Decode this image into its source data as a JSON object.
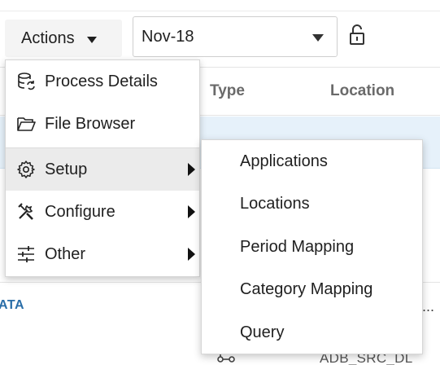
{
  "toolbar": {
    "actions_label": "Actions",
    "period_value": "Nov-18"
  },
  "table": {
    "columns": [
      "Type",
      "Location"
    ],
    "row_link_text": "ATA",
    "row_ellipsis": "...",
    "row_bottom_text": "ADB_SRC_DL"
  },
  "menu": {
    "items": [
      {
        "label": "Process Details",
        "icon": "process-details-icon"
      },
      {
        "label": "File Browser",
        "icon": "folder-icon"
      },
      {
        "label": "Setup",
        "icon": "gear-icon",
        "submenu": true,
        "active": true
      },
      {
        "label": "Configure",
        "icon": "tools-icon",
        "submenu": true
      },
      {
        "label": "Other",
        "icon": "sliders-icon",
        "submenu": true
      }
    ]
  },
  "submenu": {
    "items": [
      {
        "label": "Applications"
      },
      {
        "label": "Locations"
      },
      {
        "label": "Period Mapping"
      },
      {
        "label": "Category Mapping"
      },
      {
        "label": "Query"
      }
    ]
  },
  "colors": {
    "selected_row": "#e6f1fa",
    "link": "#2a6ea8",
    "menu_active": "#ebebeb"
  }
}
